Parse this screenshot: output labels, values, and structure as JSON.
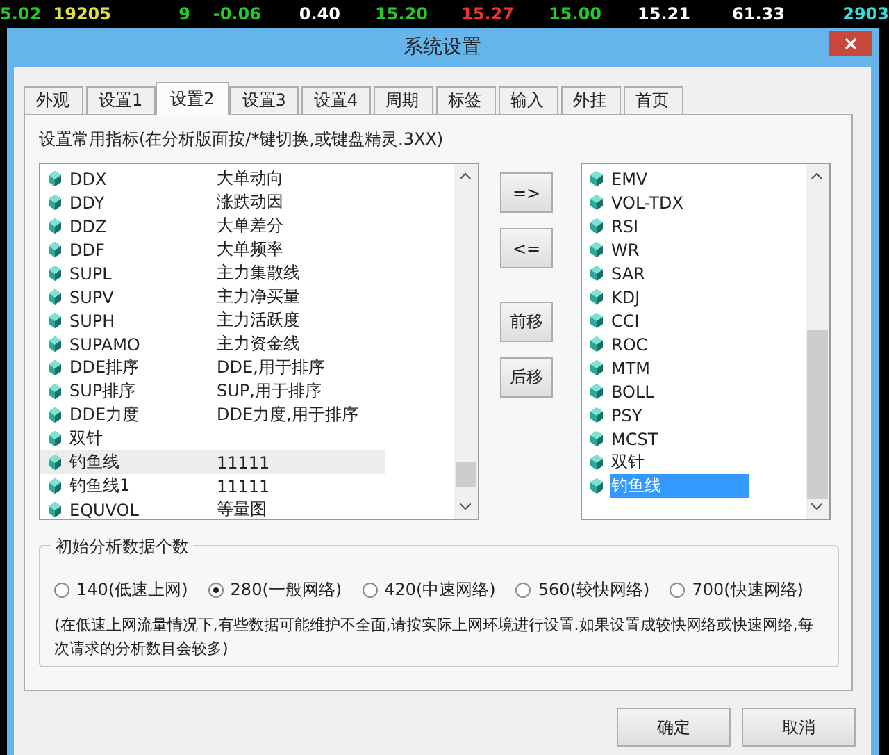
{
  "ticker": [
    {
      "text": "5.02",
      "color": "#22cc22"
    },
    {
      "text": "19205",
      "color": "#e0e040"
    },
    {
      "text": "9",
      "color": "#22cc22"
    },
    {
      "text": "-0.06",
      "color": "#22cc22"
    },
    {
      "text": "0.40",
      "color": "#ffffff"
    },
    {
      "text": "15.20",
      "color": "#22cc22"
    },
    {
      "text": "15.27",
      "color": "#ee3333"
    },
    {
      "text": "15.00",
      "color": "#22cc22"
    },
    {
      "text": "15.21",
      "color": "#ffffff"
    },
    {
      "text": "61.33",
      "color": "#ffffff"
    },
    {
      "text": "2903",
      "color": "#33dddd"
    }
  ],
  "window": {
    "title": "系统设置"
  },
  "tabs": [
    {
      "label": "外观",
      "selected": false
    },
    {
      "label": "设置1",
      "selected": false
    },
    {
      "label": "设置2",
      "selected": true
    },
    {
      "label": "设置3",
      "selected": false
    },
    {
      "label": "设置4",
      "selected": false
    },
    {
      "label": "周期",
      "selected": false
    },
    {
      "label": "标签",
      "selected": false
    },
    {
      "label": "输入",
      "selected": false
    },
    {
      "label": "外挂",
      "selected": false
    },
    {
      "label": "首页",
      "selected": false
    }
  ],
  "hint": "设置常用指标(在分析版面按/*键切换,或键盘精灵.3XX)",
  "available": [
    {
      "name": "DDX",
      "description": "大单动向",
      "selected": false
    },
    {
      "name": "DDY",
      "description": "涨跌动因",
      "selected": false
    },
    {
      "name": "DDZ",
      "description": "大单差分",
      "selected": false
    },
    {
      "name": "DDF",
      "description": "大单频率",
      "selected": false
    },
    {
      "name": "SUPL",
      "description": "主力集散线",
      "selected": false
    },
    {
      "name": "SUPV",
      "description": "主力净买量",
      "selected": false
    },
    {
      "name": "SUPH",
      "description": "主力活跃度",
      "selected": false
    },
    {
      "name": "SUPAMO",
      "description": "主力资金线",
      "selected": false
    },
    {
      "name": "DDE排序",
      "description": "DDE,用于排序",
      "selected": false
    },
    {
      "name": "SUP排序",
      "description": "SUP,用于排序",
      "selected": false
    },
    {
      "name": "DDE力度",
      "description": "DDE力度,用于排序",
      "selected": false
    },
    {
      "name": "双针",
      "selected": false
    },
    {
      "name": "钓鱼线",
      "description": "11111",
      "selected": true
    },
    {
      "name": "钓鱼线1",
      "description": "11111",
      "selected": false
    },
    {
      "name": "EQUVOL",
      "description": "等量图",
      "selected": false
    }
  ],
  "move_buttons": [
    "=>",
    "<=",
    "前移",
    "后移"
  ],
  "chosen": [
    {
      "name": "EMV",
      "selected": false
    },
    {
      "name": "VOL-TDX",
      "selected": false
    },
    {
      "name": "RSI",
      "selected": false
    },
    {
      "name": "WR",
      "selected": false
    },
    {
      "name": "SAR",
      "selected": false
    },
    {
      "name": "KDJ",
      "selected": false
    },
    {
      "name": "CCI",
      "selected": false
    },
    {
      "name": "ROC",
      "selected": false
    },
    {
      "name": "MTM",
      "selected": false
    },
    {
      "name": "BOLL",
      "selected": false
    },
    {
      "name": "PSY",
      "selected": false
    },
    {
      "name": "MCST",
      "selected": false
    },
    {
      "name": "双针",
      "selected": false
    },
    {
      "name": "钓鱼线",
      "selected": true
    }
  ],
  "data_count": {
    "title": "初始分析数据个数",
    "options": [
      {
        "label": "140(低速上网)",
        "selected": false
      },
      {
        "label": "280(一般网络)",
        "selected": true
      },
      {
        "label": "420(中速网络)",
        "selected": false
      },
      {
        "label": "560(较快网络)",
        "selected": false
      },
      {
        "label": "700(快速网络)",
        "selected": false
      }
    ],
    "note": "(在低速上网流量情况下,有些数据可能维护不全面,请按实际上网环境进行设置.如果设置成较快网络或快速网络,每次请求的分析数目会较多)"
  },
  "buttons": [
    "确定",
    "取消"
  ]
}
